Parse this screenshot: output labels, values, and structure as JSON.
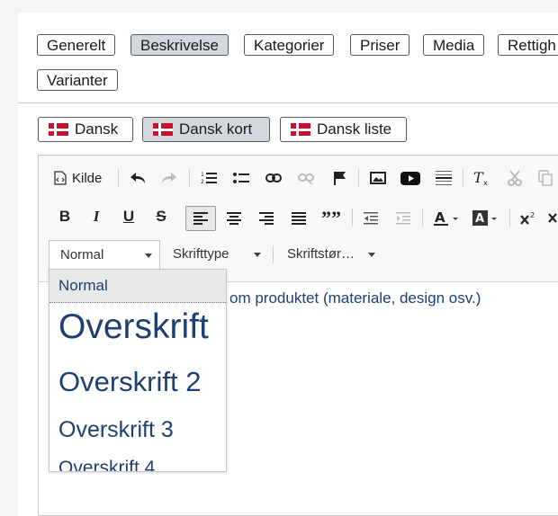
{
  "tabs": [
    "Generelt",
    "Beskrivelse",
    "Kategorier",
    "Priser",
    "Media",
    "Rettigh",
    "Varianter"
  ],
  "tabs_active": "Beskrivelse",
  "languages": [
    "Dansk",
    "Dansk kort",
    "Dansk liste"
  ],
  "language_active": "Dansk kort",
  "toolbar": {
    "source_label": "Kilde",
    "format_combo": "Normal",
    "font_combo": "Skrifttype",
    "size_combo": "Skriftstør…"
  },
  "editor": {
    "content_text": "om produktet (materiale, design osv.)"
  },
  "format_dropdown": {
    "items": [
      "Normal",
      "Overskrift",
      "Overskrift 2",
      "Overskrift 3",
      "Overskrift 4"
    ],
    "selected": "Normal"
  },
  "colors": {
    "accent_text": "#1f3f73",
    "active_bg": "#d3d8de",
    "flag_red": "#c8102e"
  }
}
